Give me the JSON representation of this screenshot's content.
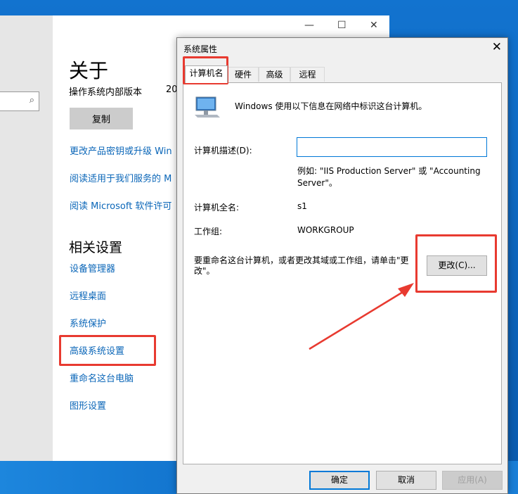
{
  "settings": {
    "about_title": "关于",
    "build_label": "操作系统内部版本",
    "build_value": "20",
    "copy_label": "复制",
    "links": [
      "更改产品密钥或升级 Win",
      "阅读适用于我们服务的 M",
      "阅读 Microsoft 软件许可"
    ],
    "related_title": "相关设置",
    "related_links": [
      "设备管理器",
      "远程桌面",
      "系统保护",
      "高级系统设置",
      "重命名这台电脑",
      "图形设置"
    ],
    "search_icon": "magnifier-icon"
  },
  "window_controls": {
    "minimize": "—",
    "maximize": "☐",
    "close": "✕"
  },
  "dialog": {
    "title": "系统属性",
    "close": "✕",
    "tabs": [
      "计算机名",
      "硬件",
      "高级",
      "远程"
    ],
    "active_tab": "计算机名",
    "intro": "Windows 使用以下信息在网络中标识这台计算机。",
    "desc_label": "计算机描述(D):",
    "desc_value": "",
    "example": "例如: \"IIS Production Server\" 或 \"Accounting Server\"。",
    "fullname_label": "计算机全名:",
    "fullname_value": "s1",
    "workgroup_label": "工作组:",
    "workgroup_value": "WORKGROUP",
    "rename_text": "要重命名这台计算机，或者更改其域或工作组，请单击\"更改\"。",
    "change_label": "更改(C)...",
    "ok_label": "确定",
    "cancel_label": "取消",
    "apply_label": "应用(A)"
  },
  "annotation_color": "#e83a30"
}
